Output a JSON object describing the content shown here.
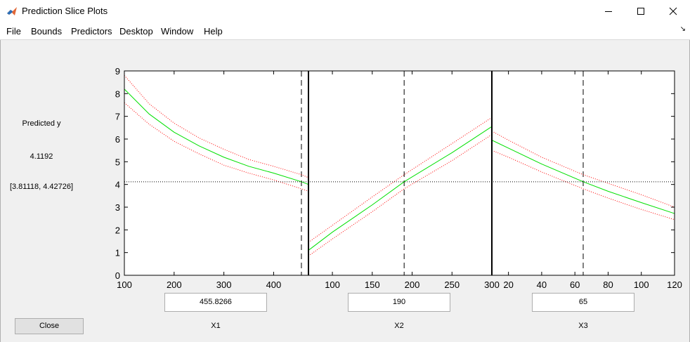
{
  "window": {
    "title": "Prediction Slice Plots",
    "controls": {
      "minimize": "minimize-icon",
      "maximize": "maximize-icon",
      "close": "close-icon"
    }
  },
  "menu": [
    "File",
    "Bounds",
    "Predictors",
    "Desktop",
    "Window",
    "Help"
  ],
  "sidebar": {
    "predicted_label": "Predicted y",
    "predicted_value": "4.1192",
    "interval": "[3.81118, 4.42726]",
    "close_label": "Close"
  },
  "predictors": [
    {
      "name": "X1",
      "value": "455.8266"
    },
    {
      "name": "X2",
      "value": "190"
    },
    {
      "name": "X3",
      "value": "65"
    }
  ],
  "colors": {
    "fit": "#00e000",
    "bounds": "#ff0000",
    "reference": "#000000"
  },
  "chart_data": {
    "type": "line",
    "ylim": [
      0,
      9
    ],
    "yticks": [
      "0",
      "1",
      "2",
      "3",
      "4",
      "5",
      "6",
      "7",
      "8",
      "9"
    ],
    "current_y": 4.1192,
    "panels": [
      {
        "xlim": [
          100,
          470
        ],
        "xticks": [
          100,
          200,
          300,
          400
        ],
        "current_x": 455.8266,
        "x": [
          100,
          150,
          200,
          250,
          300,
          350,
          400,
          455.8266,
          470
        ],
        "fit": [
          8.2,
          7.1,
          6.3,
          5.7,
          5.2,
          4.8,
          4.5,
          4.12,
          4.0
        ],
        "upper": [
          8.8,
          7.55,
          6.7,
          6.05,
          5.55,
          5.1,
          4.8,
          4.43,
          4.3
        ],
        "lower": [
          7.6,
          6.65,
          5.9,
          5.35,
          4.85,
          4.5,
          4.2,
          3.81,
          3.7
        ]
      },
      {
        "xlim": [
          70,
          300
        ],
        "xticks": [
          100,
          150,
          200,
          250,
          300
        ],
        "current_x": 190,
        "x": [
          70,
          100,
          150,
          190,
          250,
          300
        ],
        "fit": [
          1.1,
          1.9,
          3.1,
          4.12,
          5.4,
          6.55
        ],
        "upper": [
          1.45,
          2.2,
          3.45,
          4.43,
          5.8,
          6.95
        ],
        "lower": [
          0.85,
          1.6,
          2.8,
          3.81,
          5.05,
          6.2
        ]
      },
      {
        "xlim": [
          10,
          120
        ],
        "xticks": [
          20,
          40,
          60,
          80,
          100,
          120
        ],
        "current_x": 65,
        "x": [
          10,
          20,
          40,
          65,
          80,
          100,
          120
        ],
        "fit": [
          5.95,
          5.6,
          4.9,
          4.12,
          3.7,
          3.2,
          2.72
        ],
        "upper": [
          6.35,
          5.95,
          5.2,
          4.43,
          4.05,
          3.55,
          3.0
        ],
        "lower": [
          5.5,
          5.2,
          4.55,
          3.81,
          3.4,
          2.9,
          2.45
        ]
      }
    ]
  }
}
